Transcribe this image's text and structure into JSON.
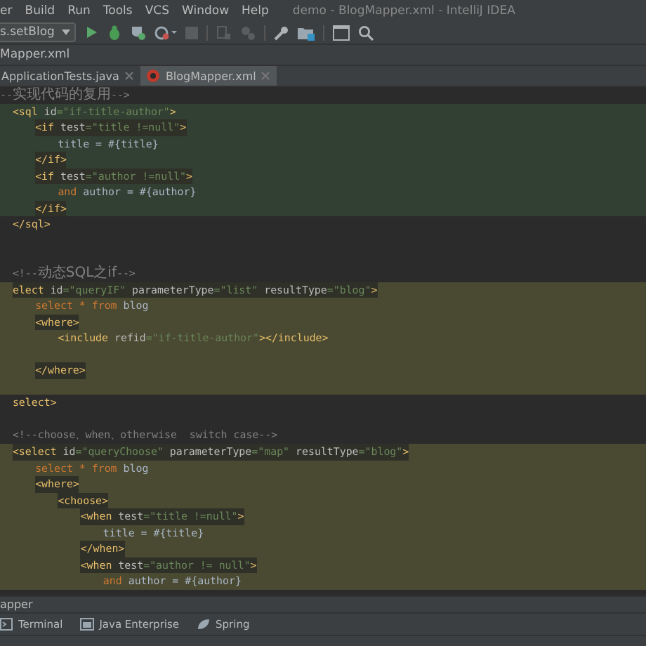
{
  "menu": {
    "items": [
      "er",
      "Build",
      "Run",
      "Tools",
      "VCS",
      "Window",
      "Help"
    ],
    "title": "demo - BlogMapper.xml - IntelliJ IDEA"
  },
  "toolbar": {
    "run_config": "s.setBlog"
  },
  "nav_bar": {
    "path": "Mapper.xml"
  },
  "tabs": [
    {
      "label": "ApplicationTests.java",
      "selected": false,
      "kind": "java"
    },
    {
      "label": "BlogMapper.xml",
      "selected": true,
      "kind": "xml"
    }
  ],
  "blocks": [
    {
      "lines": [
        {
          "tokens": [
            {
              "kind": "comment",
              "text": "--"
            },
            {
              "kind": "cjk",
              "text": "实现代码的复用"
            },
            {
              "kind": "comment",
              "text": "-->"
            }
          ]
        }
      ]
    },
    {
      "color": "#323f33",
      "lines": [
        {
          "tokens": [
            {
              "kind": "tag",
              "text": "<sql"
            },
            {
              "kind": "attr",
              "text": " id"
            },
            {
              "kind": "string",
              "text": "=\"if-title-author\""
            },
            {
              "kind": "tag",
              "text": ">"
            }
          ],
          "children": [
            {
              "hl": true,
              "tokens": [
                {
                  "kind": "tag",
                  "text": "<if"
                },
                {
                  "kind": "attr",
                  "text": " test"
                },
                {
                  "kind": "string",
                  "text": "=\"title !=null\""
                },
                {
                  "kind": "tag",
                  "text": ">"
                }
              ],
              "children": [
                {
                  "tokens": [
                    {
                      "kind": "text",
                      "text": "title = #{title}"
                    }
                  ]
                }
              ]
            },
            {
              "hl": true,
              "tokens": [
                {
                  "kind": "tag",
                  "text": "</if>"
                }
              ]
            },
            {
              "hl": true,
              "tokens": [
                {
                  "kind": "tag",
                  "text": "<if"
                },
                {
                  "kind": "attr",
                  "text": " test"
                },
                {
                  "kind": "string",
                  "text": "=\"author !=null\""
                },
                {
                  "kind": "tag",
                  "text": ">"
                }
              ],
              "children": [
                {
                  "tokens": [
                    {
                      "kind": "keyword",
                      "text": "and"
                    },
                    {
                      "kind": "text",
                      "text": " author = #{author}"
                    }
                  ]
                }
              ]
            },
            {
              "hl": true,
              "tokens": [
                {
                  "kind": "tag",
                  "text": "</if>"
                }
              ]
            }
          ]
        }
      ]
    },
    {
      "lines": [
        {
          "tokens": [
            {
              "kind": "tag",
              "text": "</sql>"
            }
          ]
        },
        {
          "kind": "blank"
        },
        {
          "kind": "blank"
        },
        {
          "tokens": [
            {
              "kind": "comment",
              "text": "<!--"
            },
            {
              "kind": "cjk",
              "text": "动态SQL之if"
            },
            {
              "kind": "comment",
              "text": "-->"
            }
          ]
        }
      ]
    },
    {
      "color": "#4a4932",
      "lines": [
        {
          "hl": true,
          "tokens": [
            {
              "kind": "tag",
              "text": "elect"
            },
            {
              "kind": "attr",
              "text": " id"
            },
            {
              "kind": "string",
              "text": "=\"queryIF\""
            },
            {
              "kind": "attr",
              "text": " parameterType"
            },
            {
              "kind": "string",
              "text": "=\"list\""
            },
            {
              "kind": "attr",
              "text": " resultType"
            },
            {
              "kind": "string",
              "text": "=\"blog\""
            },
            {
              "kind": "tag",
              "text": ">"
            }
          ],
          "children": [
            {
              "tokens": [
                {
                  "kind": "keyword",
                  "text": "select * from"
                },
                {
                  "kind": "text",
                  "text": " blog"
                }
              ]
            },
            {
              "hl": true,
              "tokens": [
                {
                  "kind": "tag",
                  "text": "<where>"
                }
              ],
              "children": [
                {
                  "tokens": [
                    {
                      "kind": "tag",
                      "text": "<include"
                    },
                    {
                      "kind": "attr",
                      "text": " refid"
                    },
                    {
                      "kind": "string",
                      "text": "=\"if-title-author\""
                    },
                    {
                      "kind": "tag",
                      "text": "></include>"
                    }
                  ]
                },
                {
                  "kind": "blank"
                }
              ]
            },
            {
              "hl": true,
              "tokens": [
                {
                  "kind": "tag",
                  "text": "</where>"
                }
              ]
            }
          ]
        },
        {
          "kind": "blank"
        }
      ]
    },
    {
      "lines": [
        {
          "tokens": [
            {
              "kind": "tag",
              "text": "select>"
            }
          ]
        },
        {
          "kind": "blank"
        },
        {
          "tokens": [
            {
              "kind": "comment",
              "text": "<!--choose、when、otherwise  switch case-->"
            }
          ]
        }
      ]
    },
    {
      "color": "#4a4932",
      "lines": [
        {
          "hl": true,
          "tokens": [
            {
              "kind": "tag",
              "text": "<select"
            },
            {
              "kind": "attr",
              "text": " id"
            },
            {
              "kind": "string",
              "text": "=\"queryChoose\""
            },
            {
              "kind": "attr",
              "text": " parameterType"
            },
            {
              "kind": "string",
              "text": "=\"map\""
            },
            {
              "kind": "attr",
              "text": " resultType"
            },
            {
              "kind": "string",
              "text": "=\"blog\""
            },
            {
              "kind": "tag",
              "text": ">"
            }
          ],
          "children": [
            {
              "tokens": [
                {
                  "kind": "keyword",
                  "text": "select * from"
                },
                {
                  "kind": "text",
                  "text": " blog"
                }
              ]
            },
            {
              "hl": true,
              "tokens": [
                {
                  "kind": "tag",
                  "text": "<where>"
                }
              ],
              "children": [
                {
                  "hl": true,
                  "tokens": [
                    {
                      "kind": "tag",
                      "text": "<choose>"
                    }
                  ],
                  "children": [
                    {
                      "hl": true,
                      "tokens": [
                        {
                          "kind": "tag",
                          "text": "<when"
                        },
                        {
                          "kind": "attr",
                          "text": " test"
                        },
                        {
                          "kind": "string",
                          "text": "=\"title !=null\""
                        },
                        {
                          "kind": "tag",
                          "text": ">"
                        }
                      ],
                      "children": [
                        {
                          "tokens": [
                            {
                              "kind": "text",
                              "text": "title = #{title}"
                            }
                          ]
                        }
                      ]
                    },
                    {
                      "hl": true,
                      "tokens": [
                        {
                          "kind": "tag",
                          "text": "</when>"
                        }
                      ]
                    },
                    {
                      "hl": true,
                      "tokens": [
                        {
                          "kind": "tag",
                          "text": "<when"
                        },
                        {
                          "kind": "attr",
                          "text": " test"
                        },
                        {
                          "kind": "string",
                          "text": "=\"author != null\""
                        },
                        {
                          "kind": "tag",
                          "text": ">"
                        }
                      ],
                      "children": [
                        {
                          "tokens": [
                            {
                              "kind": "keyword",
                              "text": "and"
                            },
                            {
                              "kind": "text",
                              "text": " author = #{author}"
                            }
                          ]
                        }
                      ]
                    }
                  ]
                }
              ]
            }
          ]
        }
      ]
    }
  ],
  "breadcrumb": "apper",
  "tool_tabs": [
    {
      "label": "Terminal",
      "kind": "terminal"
    },
    {
      "label": "Java Enterprise",
      "kind": "enterprise"
    },
    {
      "label": "Spring",
      "kind": "spring"
    }
  ]
}
